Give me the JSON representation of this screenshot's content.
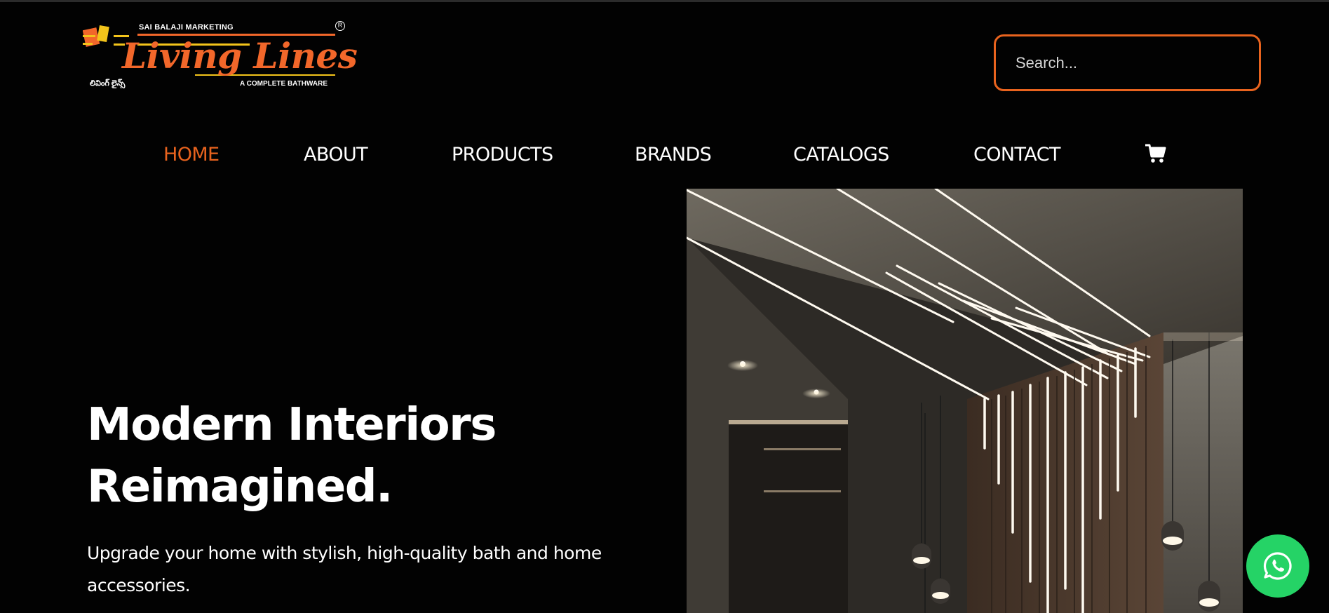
{
  "brand": {
    "company": "SAI BALAJI MARKETING",
    "name": "Living Lines",
    "registered_mark": "R",
    "telugu": "లివింగ్ లైన్స్",
    "tagline": "A COMPLETE BATHWARE",
    "accent_color": "#e8631e",
    "logo_yellow": "#f3c41b"
  },
  "search": {
    "placeholder": "Search...",
    "value": ""
  },
  "nav": {
    "items": [
      {
        "label": "HOME",
        "active": true
      },
      {
        "label": "ABOUT",
        "active": false
      },
      {
        "label": "PRODUCTS",
        "active": false
      },
      {
        "label": "BRANDS",
        "active": false
      },
      {
        "label": "CATALOGS",
        "active": false
      },
      {
        "label": "CONTACT",
        "active": false
      }
    ],
    "cart_icon": "shopping-cart-icon"
  },
  "hero": {
    "title_line1": "Modern Interiors",
    "title_line2": "Reimagined.",
    "subtitle_line1": "Upgrade your home with stylish, high-quality bath and home",
    "subtitle_line2": "accessories.",
    "image": "modern-interior-with-linear-ceiling-lights"
  },
  "floating": {
    "whatsapp_icon": "whatsapp-icon",
    "color": "#25d366"
  }
}
